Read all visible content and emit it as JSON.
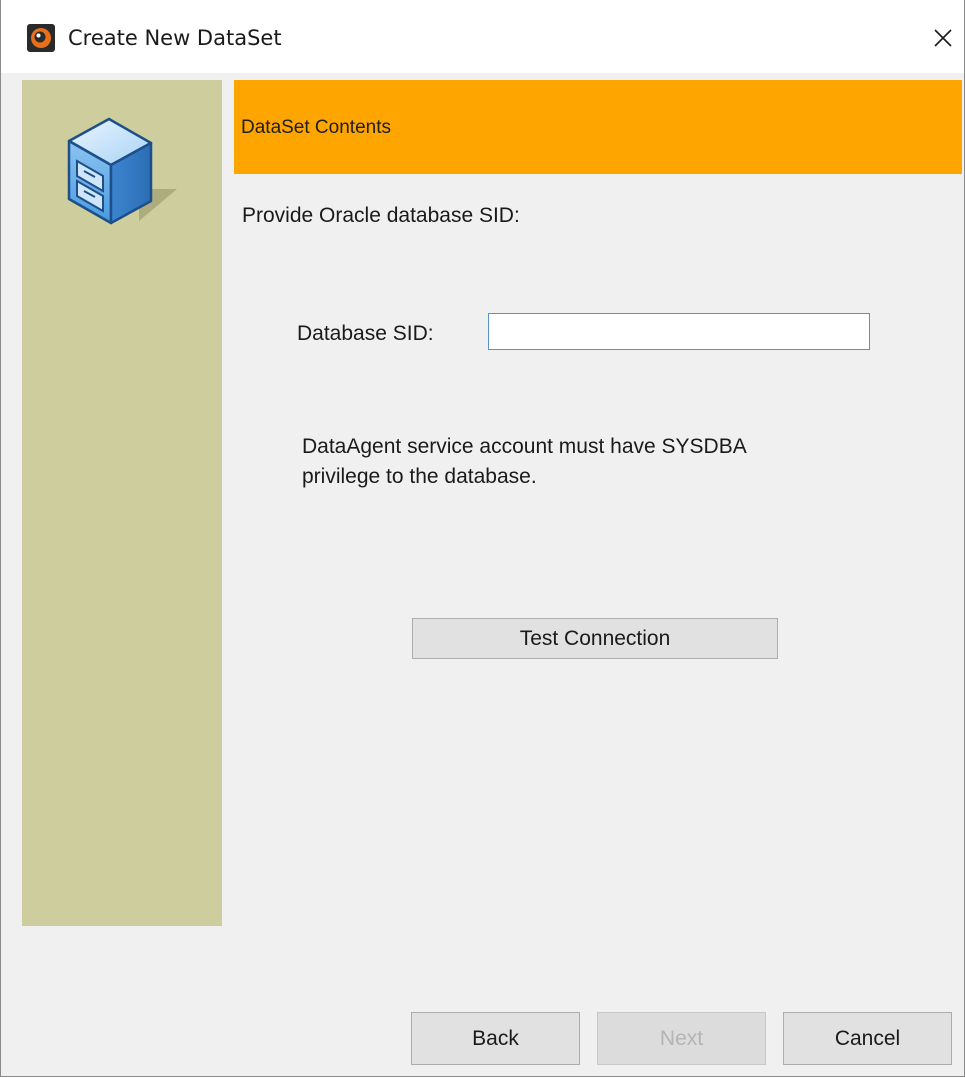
{
  "window": {
    "title": "Create New DataSet",
    "app_icon": "app-logo-icon",
    "close_icon": "close-icon"
  },
  "sidebar": {
    "icon": "file-cabinet-icon",
    "color": "#cdcd9d"
  },
  "header": {
    "title": "DataSet Contents",
    "color": "#ffa500"
  },
  "form": {
    "prompt": "Provide Oracle database SID:",
    "sid_label": "Database SID:",
    "sid_value": "",
    "note_line1": "DataAgent service account must have SYSDBA",
    "note_line2": "privilege to the database.",
    "test_button": "Test Connection"
  },
  "footer": {
    "back": "Back",
    "next": "Next",
    "next_enabled": false,
    "cancel": "Cancel"
  }
}
